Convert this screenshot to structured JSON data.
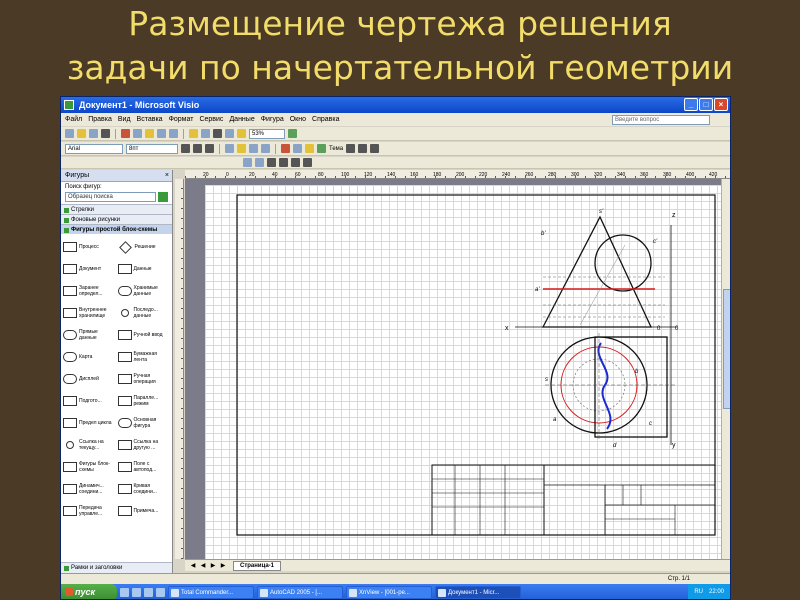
{
  "slide": {
    "title_line1": "Размещение чертежа решения",
    "title_line2": "задачи по начертательной геометрии"
  },
  "window": {
    "title": "Документ1 - Microsoft Visio",
    "controls": [
      "_",
      "□",
      "×"
    ]
  },
  "menu": {
    "items": [
      "Файл",
      "Правка",
      "Вид",
      "Вставка",
      "Формат",
      "Сервис",
      "Данные",
      "Фигура",
      "Окно",
      "Справка"
    ],
    "help_placeholder": "Введите вопрос"
  },
  "toolbar": {
    "zoom": "53%",
    "font": "Arial",
    "font_size": "8пт",
    "theme_label": "Тема"
  },
  "shapes_panel": {
    "title": "Фигуры",
    "search_label": "Поиск фигур:",
    "search_placeholder": "Образец поиска",
    "stencils": [
      "Стрелки",
      "Фоновые рисунки",
      "Фигуры простой блок-схемы"
    ],
    "footer": "Рамки и заголовки",
    "shapes": [
      {
        "label": "Процесс",
        "icon": "rect"
      },
      {
        "label": "Решение",
        "icon": "diamond"
      },
      {
        "label": "Документ",
        "icon": "rect"
      },
      {
        "label": "Данные",
        "icon": "rect"
      },
      {
        "label": "Заранее определ...",
        "icon": "rect"
      },
      {
        "label": "Хранимые данные",
        "icon": "round"
      },
      {
        "label": "Внутреннее хранилище",
        "icon": "rect"
      },
      {
        "label": "Последо... данные",
        "icon": "circle"
      },
      {
        "label": "Прямые данные",
        "icon": "round"
      },
      {
        "label": "Ручной ввод",
        "icon": "rect"
      },
      {
        "label": "Карта",
        "icon": "round"
      },
      {
        "label": "Бумажная лента",
        "icon": "rect"
      },
      {
        "label": "Дисплей",
        "icon": "round"
      },
      {
        "label": "Ручная операция",
        "icon": "rect"
      },
      {
        "label": "Подгото...",
        "icon": "rect"
      },
      {
        "label": "Паралле... режим",
        "icon": "rect"
      },
      {
        "label": "Предел цикла",
        "icon": "rect"
      },
      {
        "label": "Основная фигура",
        "icon": "round"
      },
      {
        "label": "Ссылка на текущу...",
        "icon": "circle"
      },
      {
        "label": "Ссылка на другую ...",
        "icon": "rect"
      },
      {
        "label": "Фигуры блок-схемы",
        "icon": "rect"
      },
      {
        "label": "Поле с автопод...",
        "icon": "rect"
      },
      {
        "label": "Динамич... соедини...",
        "icon": "rect"
      },
      {
        "label": "Кривая соедини...",
        "icon": "rect"
      },
      {
        "label": "Передача управле...",
        "icon": "rect"
      },
      {
        "label": "Примеча...",
        "icon": "rect"
      }
    ]
  },
  "ruler": {
    "top_ticks": [
      "20",
      "0",
      "20",
      "40",
      "60",
      "80",
      "100",
      "120",
      "140",
      "160",
      "180",
      "200",
      "220",
      "240",
      "260",
      "280",
      "300",
      "320",
      "340",
      "360",
      "380",
      "400",
      "420"
    ]
  },
  "drawing": {
    "labels": {
      "z": "z",
      "y": "y",
      "x": "x",
      "zero_front": "0",
      "zero_side": "0",
      "b_front": "b'",
      "s_front": "s'",
      "c_front": "c'",
      "a_front": "a'",
      "s_top": "s",
      "a_top": "a",
      "b_top": "b",
      "c_top": "c",
      "d_top": "d"
    },
    "colors": {
      "line": "#111111",
      "cut_plane": "#d21c1c",
      "section_curve": "#1a2ad0",
      "accent": "#c82020"
    }
  },
  "page_tabs": {
    "current": "Страница-1"
  },
  "status": {
    "page_count": "Стр. 1/1"
  },
  "taskbar": {
    "start": "пуск",
    "items": [
      {
        "label": "Total Commander...",
        "active": false
      },
      {
        "label": "AutoCAD 2005 - [...",
        "active": false
      },
      {
        "label": "XnView - [001-ре...",
        "active": false
      },
      {
        "label": "Документ1 - Micr...",
        "active": true
      }
    ],
    "lang": "RU",
    "clock": "22:00"
  }
}
